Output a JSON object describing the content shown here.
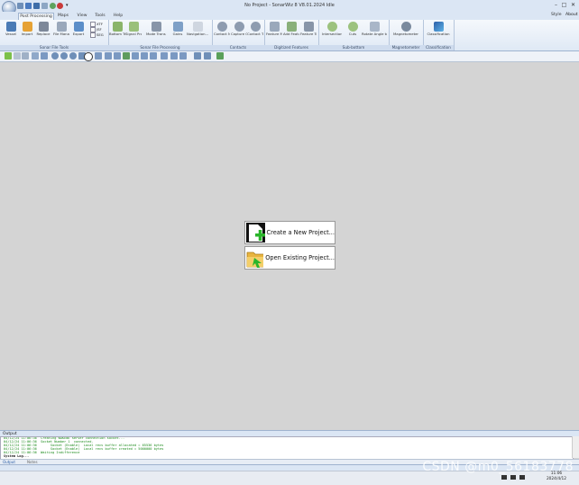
{
  "window": {
    "title": "No Project - SonarWiz 8 V8.01.2024 Idle",
    "style_label": "Style",
    "about_label": "About",
    "min_glyph": "–",
    "max_glyph": "□",
    "close_glyph": "✕"
  },
  "tabs": [
    {
      "label": "Post Processing",
      "active": true
    },
    {
      "label": "Maps"
    },
    {
      "label": "View"
    },
    {
      "label": "Tools"
    },
    {
      "label": "Help"
    }
  ],
  "ribbon": {
    "groups": [
      {
        "label": "Sonar File Tools"
      },
      {
        "label": "Sonar File Processing"
      },
      {
        "label": "Contacts"
      },
      {
        "label": "Digitized Features"
      },
      {
        "label": "Sub-bottom"
      },
      {
        "label": "Magnetometer"
      },
      {
        "label": "Classification"
      }
    ],
    "buttons": {
      "vessel": "Vessel",
      "import": "Import",
      "replace": "Replace",
      "file_manager": "File Manager",
      "export": "Export",
      "bottom_track": "Bottom Track...",
      "signal_processing": "Signal Proc...",
      "mode_transparency": "Mode Transparency",
      "gains": "Gains",
      "navigation": "Navigation...",
      "contact_manager": "Contact Manager",
      "capture_contact": "Capture Contact",
      "contact_tools": "Contact Tools",
      "feature_manager": "Feature Manager",
      "add_feature": "Add Feature",
      "feature_tools": "Feature Tools",
      "intersections": "Intersections",
      "cuts": "Cuts",
      "rotate": "Rotate Angle to Bathy Grid...",
      "magnetometer": "Magnetometer",
      "classification": "Classification"
    },
    "checks": [
      "XTF",
      "JSF",
      "SEG"
    ]
  },
  "start": {
    "create_label": "Create a New Project...",
    "open_label": "Open Existing Project..."
  },
  "output": {
    "title": "Output",
    "lines": [
      "04/12/24 11:06:36  Creating WAKENE server connection socket...",
      "04/12/24 11:06:36  Socket Number 1  connected.",
      "04/12/24 11:06:36       Socket (Enable)  Local recv buffer allocated = 65536 bytes",
      "04/12/24 11:06:36       Socket (Enable)  Local recv buffer created = 5000000 bytes",
      "04/12/24 11:06:36  Waiting Indifference"
    ],
    "system_log": "System Log..."
  },
  "output_tabs": {
    "tab1": "Output",
    "tab2": "Notes"
  },
  "taskbar": {
    "time": "11:06",
    "date": "2024/4/12"
  },
  "watermark": "CSDN @m0_56183778"
}
